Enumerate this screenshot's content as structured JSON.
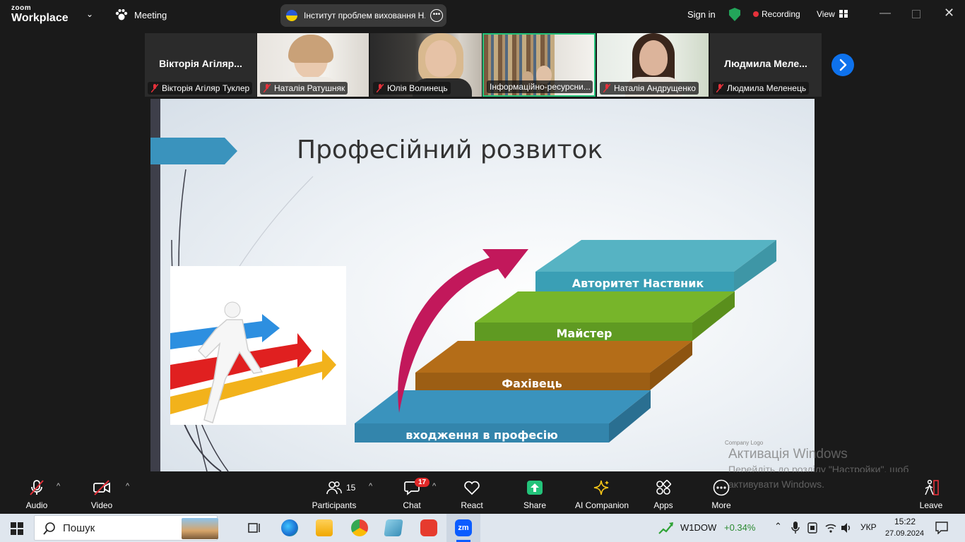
{
  "app": {
    "brand_top": "zoom",
    "brand_bottom": "Workplace",
    "meeting_menu": "Meeting",
    "meeting_title": "Інститут проблем виховання Н.",
    "sign_in": "Sign in",
    "recording": "Recording",
    "view": "View"
  },
  "participants": [
    {
      "big_name": "Вікторія Агіляр...",
      "label": "Вікторія Агіляр Туклер"
    },
    {
      "label": "Наталія Ратушняк"
    },
    {
      "label": "Юлія Волинець"
    },
    {
      "label": "Інформаційно-ресурсни..."
    },
    {
      "label": "Наталія Андрущенко"
    },
    {
      "big_name": "Людмила  Меле...",
      "label": "Людмила Меленець"
    }
  ],
  "slide": {
    "title": "Професійний розвиток",
    "steps": [
      "входження в професію",
      "Фахівець",
      "Майстер",
      "Авторитет  Наствник"
    ],
    "company_logo": "Company Logo"
  },
  "activation": {
    "line1": "Активація Windows",
    "line2": "Перейдіть до розділу \"Настройки\", щоб",
    "line3": "активувати Windows."
  },
  "toolbar": {
    "audio": "Audio",
    "video": "Video",
    "participants": "Participants",
    "participants_count": "15",
    "chat": "Chat",
    "chat_badge": "17",
    "react": "React",
    "share": "Share",
    "ai": "AI Companion",
    "apps": "Apps",
    "more": "More",
    "leave": "Leave"
  },
  "taskbar": {
    "search": "Пошук",
    "stock_name": "W1DOW",
    "stock_change": "+0.34%",
    "lang": "УКР",
    "time": "15:22",
    "date": "27.09.2024"
  },
  "colors": {
    "accent": "#0e72ed",
    "share_green": "#23c37a",
    "step_blue": "#3a93bd",
    "step_brown": "#b06a16",
    "step_green": "#6aa324",
    "step_teal": "#56b3c3",
    "arrow_magenta": "#c2185b"
  }
}
